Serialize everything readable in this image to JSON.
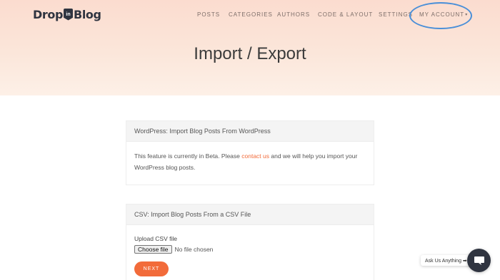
{
  "logo": {
    "part1": "Drop",
    "badge": "in",
    "part2": "Blog"
  },
  "nav": {
    "posts": "POSTS",
    "categories": "CATEGORIES",
    "authors": "AUTHORS",
    "code_layout": "CODE & LAYOUT",
    "settings": "SETTINGS",
    "my_account": "MY ACCOUNT"
  },
  "page": {
    "title": "Import / Export"
  },
  "wordpress_card": {
    "header": "WordPress: Import Blog Posts From WordPress",
    "text_before": "This feature is currently in Beta. Please ",
    "link": "contact us",
    "text_after": " and we will help you import your WordPress blog posts."
  },
  "csv_card": {
    "header": "CSV: Import Blog Posts From a CSV File",
    "upload_label": "Upload CSV file",
    "choose_file": "Choose file",
    "file_status": "No file chosen",
    "next_label": "NEXT"
  },
  "chat": {
    "bubble": "Ask Us Anything ➡"
  },
  "colors": {
    "accent": "#f26b3a",
    "annotation": "#4a8fd8",
    "dark": "#2f3440"
  },
  "icons": {
    "chat": "chat-bubble-icon",
    "dropdown": "caret-down-icon"
  }
}
